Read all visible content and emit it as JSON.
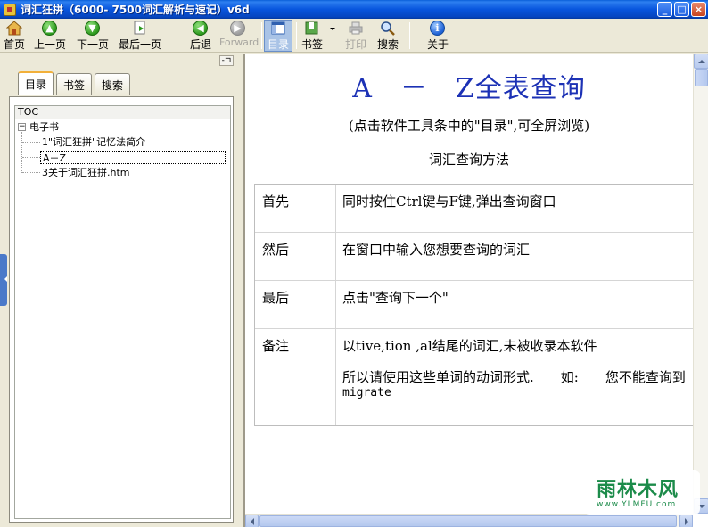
{
  "window": {
    "title": "词汇狂拼（6000- 7500词汇解析与速记）v6d",
    "min": "_",
    "max": "□",
    "close": "×"
  },
  "toolbar": {
    "home": "首页",
    "prev": "上一页",
    "next": "下一页",
    "last": "最后一页",
    "back": "后退",
    "forward": "Forward",
    "toc": "目录",
    "bookmark": "书签",
    "print": "打印",
    "search": "搜索",
    "about": "关于"
  },
  "sidebar": {
    "tabs": [
      "目录",
      "书签",
      "搜索"
    ],
    "active_tab": "目录",
    "pin": "-⊐",
    "toc_header": "TOC",
    "tree": {
      "root": "电子书",
      "expander": "−",
      "items": [
        "1\"词汇狂拼\"记忆法简介",
        "A－Z",
        "3关于词汇狂拼.htm"
      ],
      "selected": "A－Z"
    }
  },
  "content": {
    "title": "A　－　Z全表查询",
    "subtitle": "(点击软件工具条中的\"目录\",可全屏浏览)",
    "section": "词汇查询方法",
    "rows": [
      {
        "label": "首先",
        "text": [
          "同时按住Ctrl键与F键,弹出查询窗口"
        ]
      },
      {
        "label": "然后",
        "text": [
          "在窗口中输入您想要查询的词汇"
        ]
      },
      {
        "label": "最后",
        "text": [
          "点击\"查询下一个\""
        ]
      },
      {
        "label": "备注",
        "text": [
          "以tive,tion ,al结尾的词汇,未被收录本软件",
          "所以请使用这些单词的动词形式.　　如:　　您不能查询到",
          "migrate"
        ]
      }
    ]
  },
  "watermark": {
    "name": "雨林木风",
    "url": "www.YLMFU.com"
  }
}
